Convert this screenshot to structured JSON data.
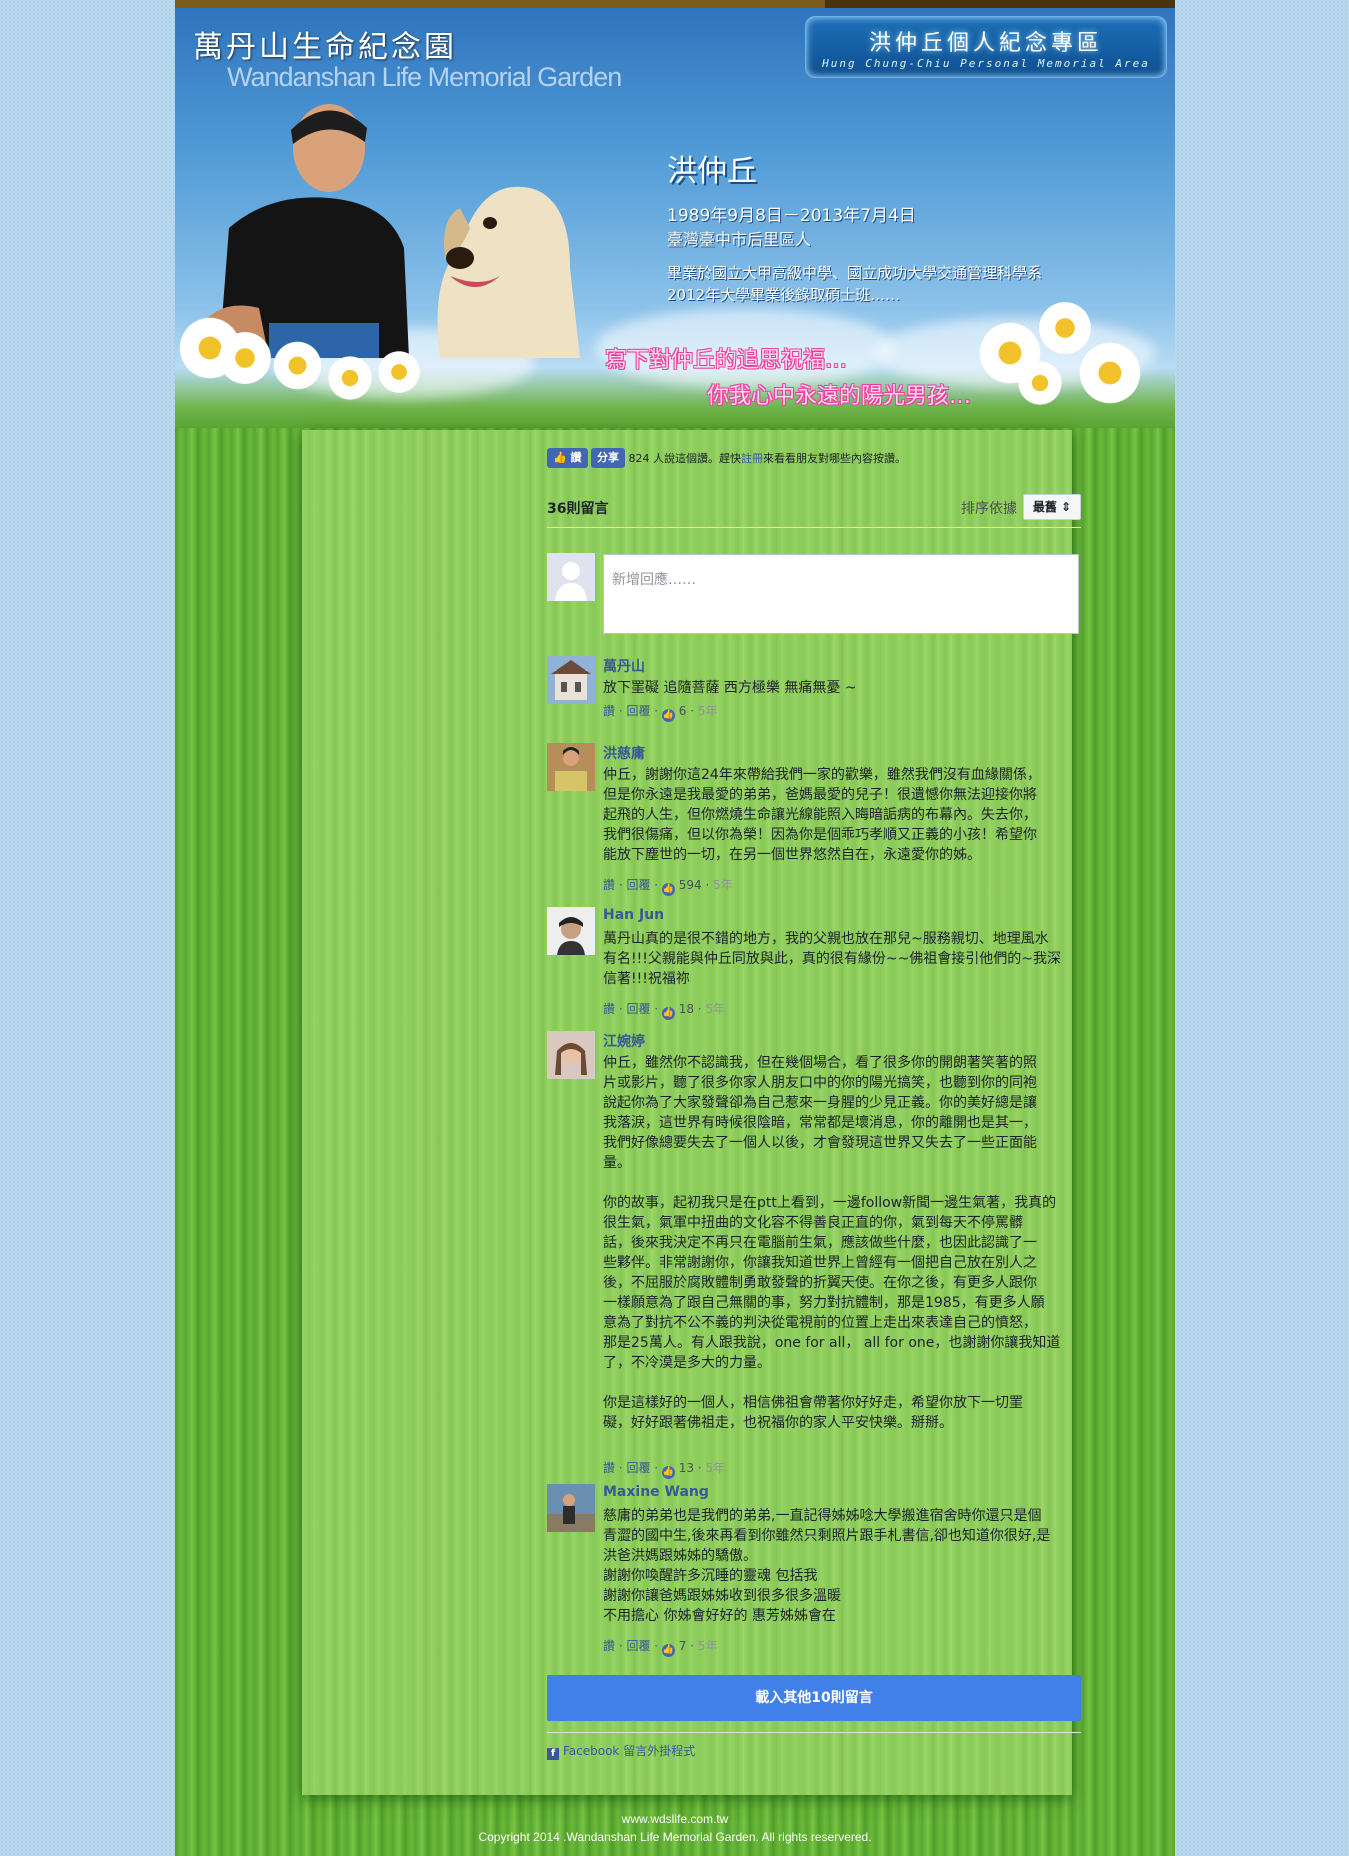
{
  "header": {
    "logo_cn": "萬丹山生命紀念園",
    "logo_en": "Wandanshan Life Memorial Garden",
    "area_cn": "洪仲丘個人紀念專區",
    "area_en": "Hung Chung-Chiu Personal Memorial Area",
    "name": "洪仲丘",
    "dates": "1989年9月8日－2013年7月4日",
    "origin": "臺灣臺中市后里區人",
    "edu_line1": "畢業於國立大甲高級中學、國立成功大學交通管理科學系",
    "edu_line2": "2012年大學畢業後錄取碩士班……",
    "tagline1": "寫下對仲丘的追思祝福…",
    "tagline2": "你我心中永遠的陽光男孩…"
  },
  "fb": {
    "like_label": "讚",
    "share_label": "分享",
    "like_text_pre": "824 人說這個讚。趕快",
    "like_text_link": "註冊",
    "like_text_post": "來看看朋友對哪些內容按讚。",
    "comment_count": "36則留言",
    "sort_label": "排序依據",
    "sort_value": "最舊",
    "reply_placeholder": "新增回應……",
    "load_more": "載入其他10則留言",
    "plugin_label": "Facebook 留言外掛程式"
  },
  "comments": [
    {
      "name": "萬丹山",
      "body": "放下罣礙 追隨菩薩 西方極樂 無痛無憂 ~",
      "actions": "讚 · 回覆 ·",
      "likes": "6",
      "time": "5年"
    },
    {
      "name": "洪慈庸",
      "body": "仲丘，謝謝你這24年來帶給我們一家的歡樂，雖然我們沒有血緣關係，\n但是你永遠是我最愛的弟弟，爸媽最愛的兒子！很遺憾你無法迎接你將\n起飛的人生，但你燃燒生命讓光線能照入晦暗詬病的布幕內。失去你，\n我們很傷痛，但以你為榮！因為你是個乖巧孝順又正義的小孩！希望你\n能放下塵世的一切，在另一個世界悠然自在，永遠愛你的姊。",
      "actions": "讚 · 回覆 ·",
      "likes": "594",
      "time": "5年"
    },
    {
      "name": "Han Jun",
      "body": "萬丹山真的是很不錯的地方，我的父親也放在那兒~服務親切、地理風水\n有名!!!父親能與仲丘同放與此，真的很有緣份~~佛祖會接引他們的~我深\n信著!!!祝福祢",
      "actions": "讚 · 回覆 ·",
      "likes": "18",
      "time": "5年"
    },
    {
      "name": "江婉婷",
      "body": "仲丘，雖然你不認識我，但在幾個場合，看了很多你的開朗著笑著的照\n片或影片，聽了很多你家人朋友口中的你的陽光搞笑，也聽到你的同袍\n說起你為了大家發聲卻為自己惹來一身腥的少見正義。你的美好總是讓\n我落淚，這世界有時候很陰暗，常常都是壞消息，你的離開也是其一，\n我們好像總要失去了一個人以後，才會發現這世界又失去了一些正面能\n量。\n\n你的故事，起初我只是在ptt上看到，一邊follow新聞一邊生氣著，我真的\n很生氣，氣軍中扭曲的文化容不得善良正直的你，氣到每天不停罵髒\n話，後來我決定不再只在電腦前生氣，應該做些什麼，也因此認識了一\n些夥伴。非常謝謝你，你讓我知道世界上曾經有一個把自己放在別人之\n後，不屈服於腐敗體制勇敢發聲的折翼天使。在你之後，有更多人跟你\n一樣願意為了跟自己無關的事，努力對抗體制，那是1985，有更多人願\n意為了對抗不公不義的判決從電視前的位置上走出來表達自己的憤怒，\n那是25萬人。有人跟我說，one for all， all for one，也謝謝你讓我知道\n了，不冷漠是多大的力量。\n\n你是這樣好的一個人，相信佛祖會帶著你好好走，希望你放下一切罣\n礙，好好跟著佛祖走，也祝福你的家人平安快樂。掰掰。",
      "actions": "讚 · 回覆 ·",
      "likes": "13",
      "time": "5年"
    },
    {
      "name": "Maxine Wang",
      "body": "慈庸的弟弟也是我們的弟弟,一直記得姊姊唸大學搬進宿舍時你還只是個\n青澀的國中生,後來再看到你雖然只剩照片跟手札書信,卻也知道你很好,是\n洪爸洪媽跟姊姊的驕傲。\n謝謝你喚醒許多沉睡的靈魂 包括我\n謝謝你讓爸媽跟姊姊收到很多很多溫暖\n不用擔心 你姊會好好的 惠芳姊姊會在",
      "actions": "讚 · 回覆 ·",
      "likes": "7",
      "time": "5年"
    }
  ],
  "footer": {
    "site": "www.wdslife.com.tw",
    "copyright": "Copyright 2014 .Wandanshan Life Memorial Garden. All rights reservered."
  }
}
